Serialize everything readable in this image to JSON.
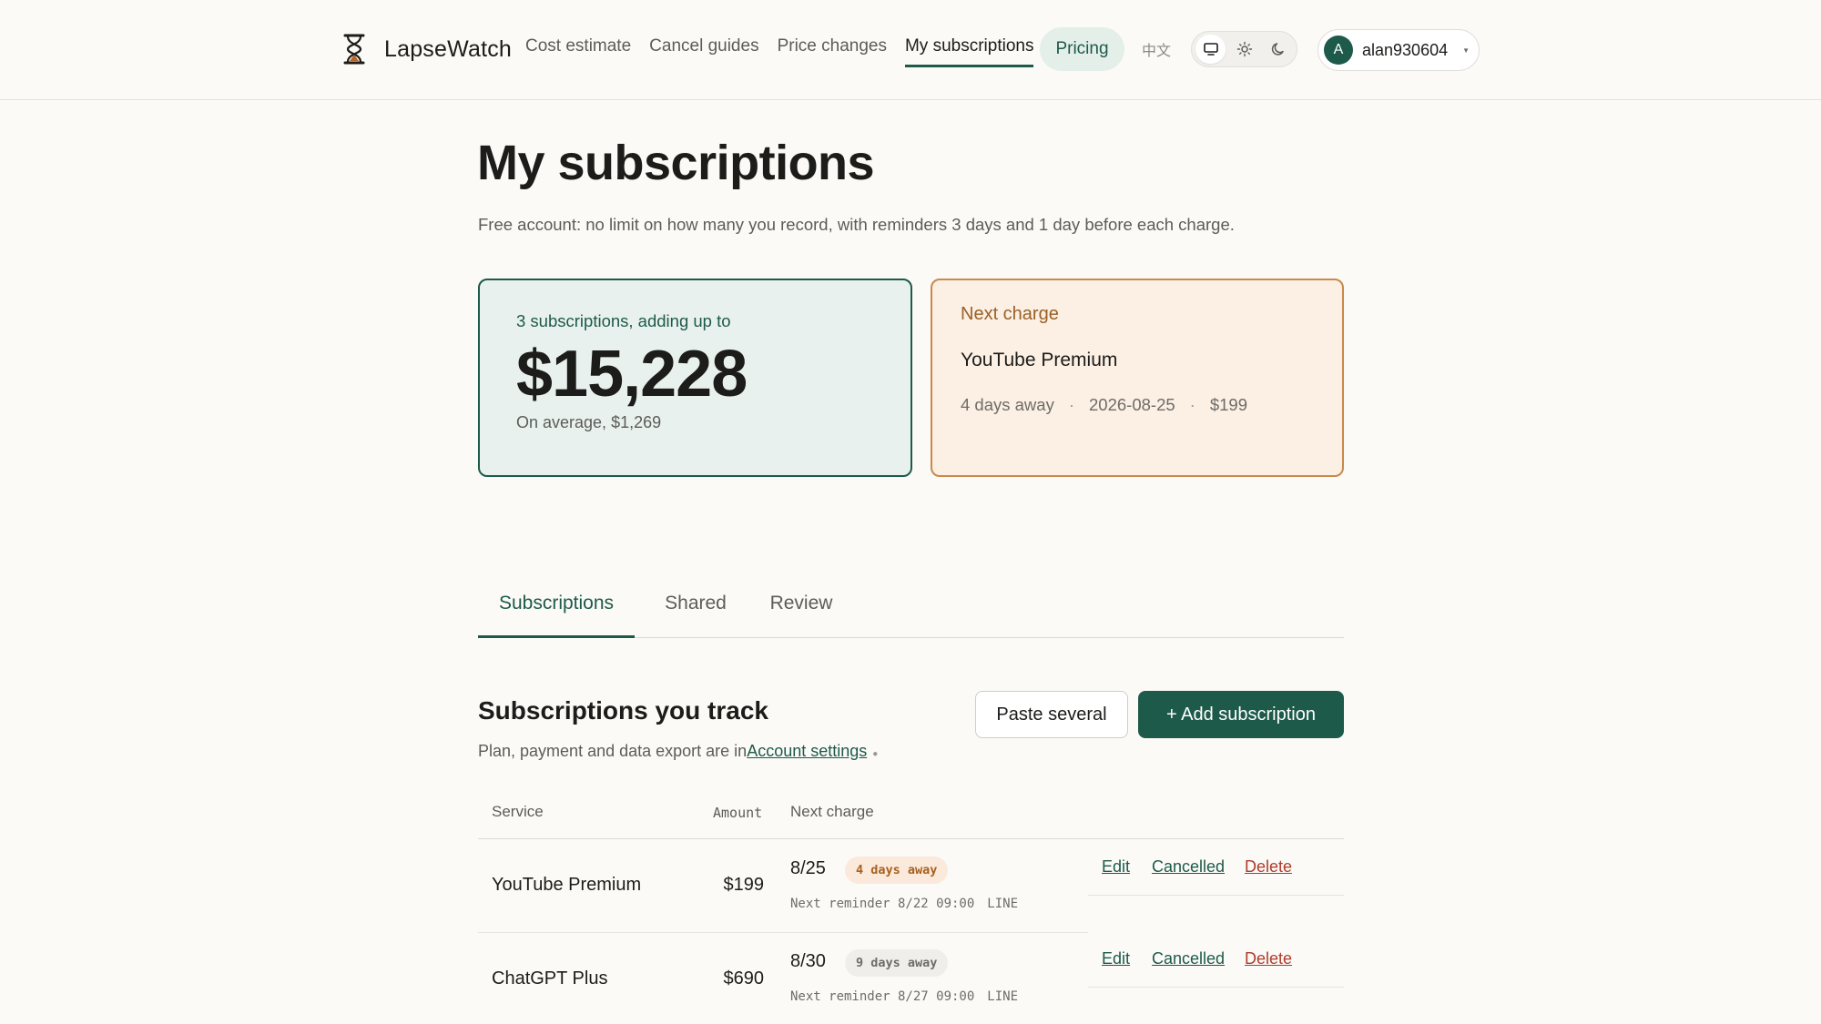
{
  "header": {
    "brand": "LapseWatch",
    "nav": [
      "Cost estimate",
      "Cancel guides",
      "Price changes",
      "My subscriptions"
    ],
    "active_nav": "My subscriptions",
    "pricing": "Pricing",
    "lang": "中文",
    "theme_icons": [
      "monitor-icon",
      "sun-icon",
      "moon-icon"
    ],
    "user": {
      "initial": "A",
      "name": "alan930604"
    }
  },
  "page": {
    "title": "My subscriptions",
    "subtitle": "Free account: no limit on how many you record, with reminders 3 days and 1 day before each charge."
  },
  "summary": {
    "label": "3 subscriptions, adding up to",
    "total": "$15,228",
    "average": "On average, $1,269"
  },
  "next_charge": {
    "label": "Next charge",
    "service": "YouTube Premium",
    "days": "4 days away",
    "date": "2026-08-25",
    "amount": "$199"
  },
  "tabs": [
    "Subscriptions",
    "Shared",
    "Review"
  ],
  "section": {
    "title": "Subscriptions you track",
    "subtitle_prefix": "Plan, payment and data export are in",
    "subtitle_link": "Account settings",
    "paste_button": "Paste several",
    "add_button": "+ Add subscription"
  },
  "table": {
    "headers": {
      "service": "Service",
      "amount": "Amount",
      "next": "Next charge"
    },
    "rows": [
      {
        "service": "YouTube Premium",
        "amount": "$199",
        "date": "8/25",
        "badge": "4 days away",
        "reminder": "Next reminder 8/22 09:00",
        "channel": "LINE",
        "actions": [
          "Edit",
          "Cancelled",
          "Delete"
        ]
      },
      {
        "service": "ChatGPT Plus",
        "amount": "$690",
        "date": "8/30",
        "badge": "9 days away",
        "reminder": "Next reminder 8/27 09:00",
        "channel": "LINE",
        "actions": [
          "Edit",
          "Cancelled",
          "Delete"
        ]
      }
    ]
  },
  "colors": {
    "accent": "#1d5a4a",
    "warn": "#c9894a",
    "danger": "#b03b2c",
    "background": "#fbfaf7"
  }
}
